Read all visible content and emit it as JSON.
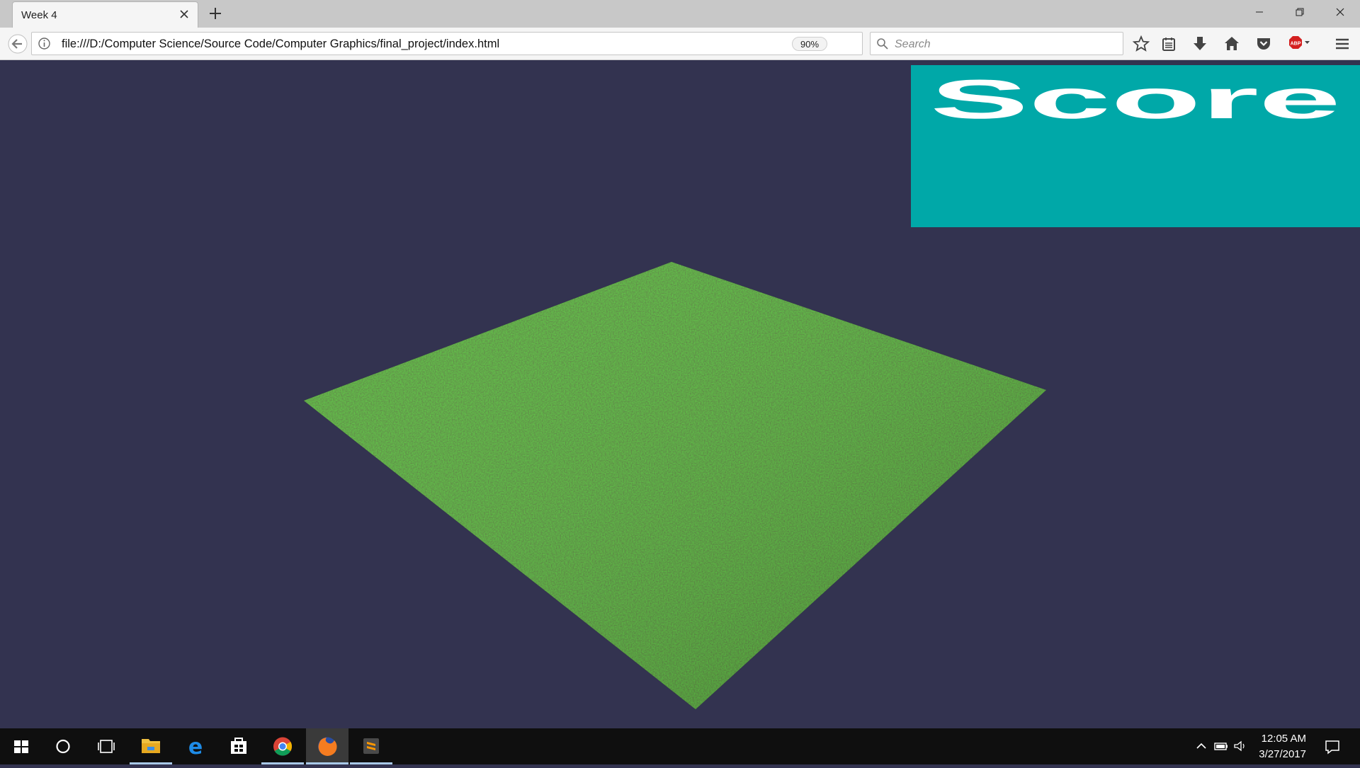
{
  "browser": {
    "tab": {
      "title": "Week 4"
    },
    "url": "file:///D:/Computer Science/Source Code/Computer Graphics/final_project/index.html",
    "zoom": "90%",
    "search": {
      "placeholder": "Search"
    },
    "toolbar_icons": [
      "star-icon",
      "reading-list-icon",
      "download-icon",
      "home-icon",
      "pocket-icon",
      "adblock-icon",
      "menu-icon"
    ]
  },
  "game": {
    "score_label": "Score",
    "background_color": "#333350",
    "ground_color": "#2e5a1e",
    "score_panel_color": "#00a8a8"
  },
  "taskbar": {
    "apps": [
      "start-icon",
      "cortana-icon",
      "task-view-icon",
      "file-explorer-icon",
      "edge-icon",
      "store-icon",
      "chrome-icon",
      "firefox-icon",
      "sublime-text-icon"
    ],
    "clock": {
      "time": "12:05 AM",
      "date": "3/27/2017"
    }
  }
}
